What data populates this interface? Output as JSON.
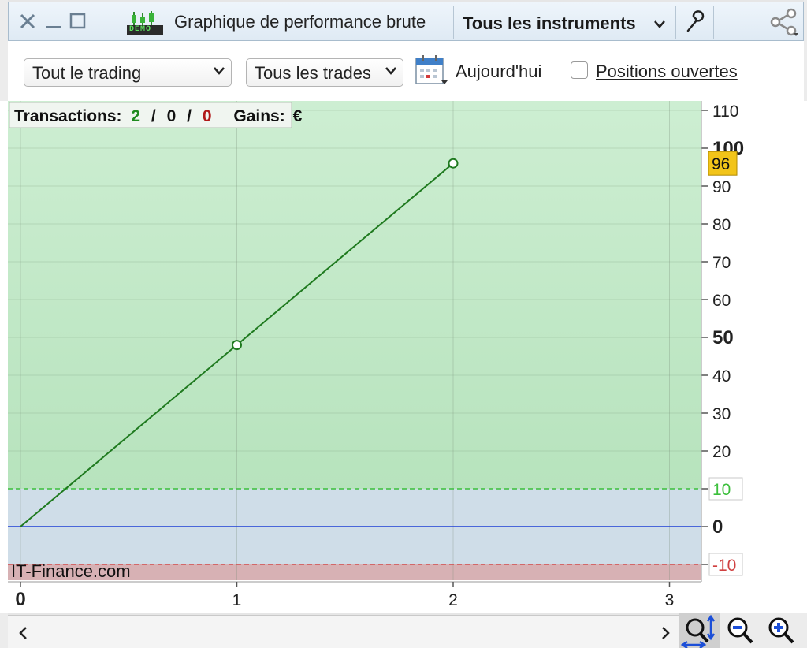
{
  "window": {
    "title": "Graphique de performance brute",
    "instrument_selector": "Tous les instruments",
    "demo_badge": "DEMO"
  },
  "toolbar": {
    "trading_select": "Tout le trading",
    "trades_select": "Tous les trades",
    "date_label": "Aujourd'hui",
    "open_positions_label": "Positions ouvertes",
    "open_positions_checked": false
  },
  "summary": {
    "transactions_label": "Transactions:",
    "transactions_total": "2",
    "transactions_sep1": "/",
    "transactions_mid": "0",
    "transactions_sep2": "/",
    "transactions_losses": "0",
    "gains_label": "Gains:",
    "gains_value": "€"
  },
  "watermark": "IT-Finance.com",
  "colors": {
    "profit_zone": "#b7e3bd",
    "neutral_zone": "#cfdde8",
    "loss_zone": "#d7b1b4",
    "line": "#1f7a1f",
    "zero_line": "#1f3fd6",
    "current_value_badge": "#f2c419"
  },
  "chart_data": {
    "type": "line",
    "series": [
      {
        "x": [
          0,
          1,
          2
        ],
        "y": [
          0,
          48,
          96
        ]
      }
    ],
    "xlim": [
      0,
      3
    ],
    "ylim": [
      -12,
      112
    ],
    "x_ticks": [
      "0",
      "1",
      "2",
      "3"
    ],
    "y_ticks": [
      "110",
      "100",
      "90",
      "80",
      "70",
      "60",
      "50",
      "40",
      "30",
      "20",
      "10",
      "0",
      "-10"
    ],
    "current_value_label": "96",
    "upper_threshold": 10,
    "lower_threshold": -10,
    "grid": true
  }
}
